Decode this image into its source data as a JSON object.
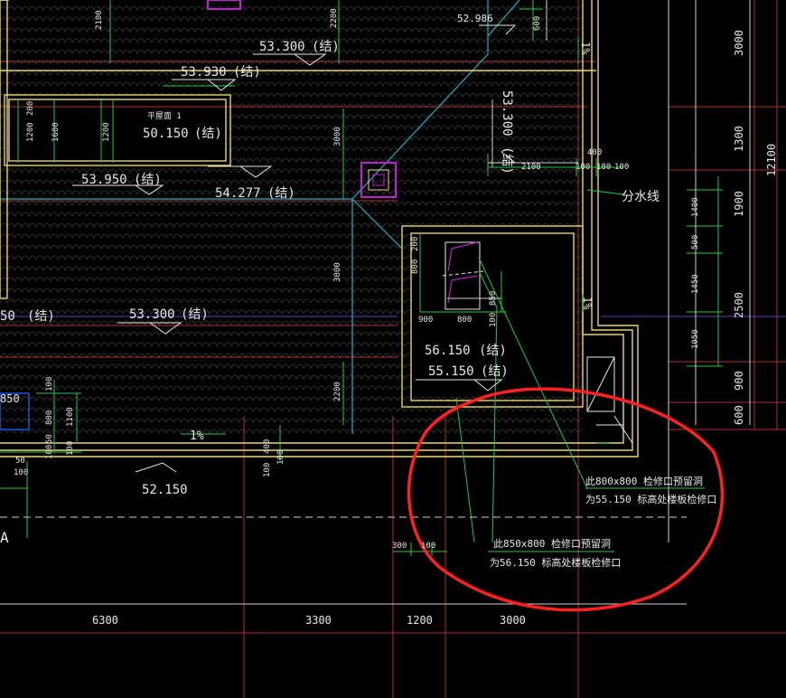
{
  "colors": {
    "background": "#000000",
    "wall": "#e8d470",
    "yellow": "#f0e040",
    "grid": "#b03030",
    "dim": "#e8e8e8",
    "green": "#27c93f",
    "cyan": "#1fb0c8",
    "magenta": "#c020d0",
    "purple": "#6040c0",
    "annotation": "#ff2020",
    "tile": "#3a3a3a"
  },
  "elevations": {
    "e1": "52.986",
    "e2": "53.300",
    "e3": "53.930",
    "e4": "50.150",
    "e5": "53.950",
    "e6": "54.277",
    "e7": "53.300",
    "e8": "53.300",
    "e9": "56.150",
    "e10": "55.150",
    "e11": "52.150",
    "e12": "50",
    "e13": "850"
  },
  "struct_mark": "(结)",
  "small_labels": {
    "tag1": "平屋面 1",
    "divide_line": "分水线",
    "slope": "1%",
    "axis_a": "A"
  },
  "dims": {
    "d2100a": "2100",
    "d600": "600",
    "d2200a": "2200",
    "d3000a": "3000",
    "d1200a": "1200",
    "d1600": "1600",
    "d1200b": "1200",
    "d200a": "200",
    "d400": "400",
    "d2100b": "2100",
    "d100a": "100",
    "d180": "180",
    "d100b": "100",
    "d200b": "200",
    "d800a": "800",
    "d850": "850",
    "d900a": "900",
    "d800b": "800",
    "d100c": "100",
    "d3000b": "3000",
    "d2200b": "2200",
    "d400b": "400",
    "d100d": "100",
    "d100e": "100",
    "d100f": "100",
    "d800c": "800",
    "d1100": "1100",
    "d50a": "50",
    "d100g": "100",
    "d100h": "100",
    "d50b": "50",
    "d100i": "100",
    "d1400": "1400",
    "d500": "500",
    "d1450": "1450",
    "d1050": "1050",
    "d300": "300",
    "d100j": "100"
  },
  "right_dims": [
    "3000",
    "1300",
    "1900",
    "2500",
    "900",
    "600"
  ],
  "right_total": "12100",
  "bottom_dims": [
    "6300",
    "3300",
    "1200",
    "3000"
  ],
  "notes": {
    "note1_l1": "此800x800 检修口预留洞",
    "note1_l2": "为55.150 标高处楼板检修口",
    "note2_l1": "此850x800 检修口预留洞",
    "note2_l2": "为56.150 标高处楼板检修口"
  }
}
